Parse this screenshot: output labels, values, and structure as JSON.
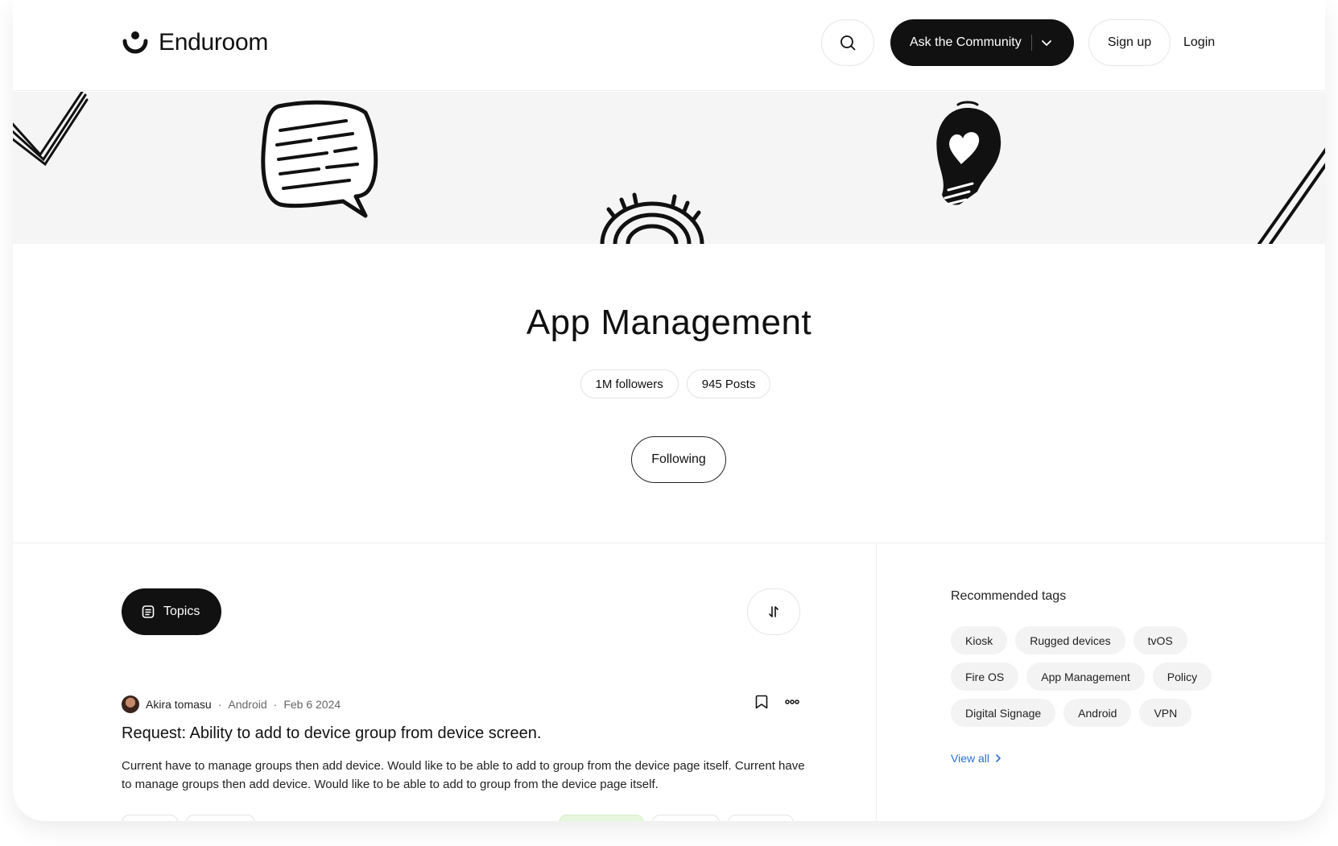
{
  "header": {
    "brand": "Enduroom",
    "ask_label": "Ask the Community",
    "signup_label": "Sign up",
    "login_label": "Login"
  },
  "hero": {
    "title": "App Management",
    "followers": "1M followers",
    "posts": "945 Posts",
    "follow_label": "Following"
  },
  "feed": {
    "topics_label": "Topics",
    "post": {
      "author": "Akira tomasu",
      "category": "Android",
      "date": "Feb 6 2024",
      "title": "Request: Ability to add to device group from device screen.",
      "body": "Current have to manage groups then add device. Would like to be able to add to group from the device page itself. Current have to manage groups then add device. Would like to be able to add to group from the device page itself."
    }
  },
  "sidebar": {
    "title": "Recommended tags",
    "tags": [
      "Kiosk",
      "Rugged devices",
      "tvOS",
      "Fire OS",
      "App Management",
      "Policy",
      "Digital Signage",
      "Android",
      "VPN"
    ],
    "view_all": "View all"
  },
  "colors": {
    "primary": "#111111",
    "banner_bg": "#f5f5f5",
    "tag_bg": "#f3f3f3",
    "link": "#2d6fd6"
  }
}
